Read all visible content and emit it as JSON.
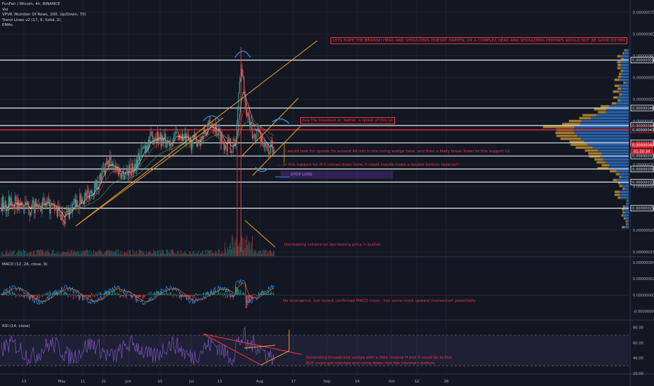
{
  "legend": {
    "symbol": "FunFair / Bitcoin, 4h, BINANCE",
    "vol": "Vol",
    "vpvr": "VPVR (Number Of Rows, 200, Up/Down, 70)",
    "trend": "Trend Lines v2 (17, 9, Solid, 2)",
    "emas": "EMAs"
  },
  "panels": {
    "macd_label": "MACD (12, 26, close, 9)",
    "rsi_label": "RSI (14, close)"
  },
  "annotations": {
    "head_shoulders": "LETS HOPE THE BEARISH HEAD AND SHOULDERS DOESNT HAPPEN, OR A COMPLEX HEAD AND SHOULDERS PERHAPS WOULD NOT BE GOOD EITHER",
    "buy_breakout": "buy the breakout or, better, a retest of this lvl",
    "upside": "I would look for upside (to around 44 ish) in the rising wedge here, and then a likely break lower to this support lvl",
    "support": "... or this support lvl.  If it comes down here, it could maybe make a double bottom reversal?",
    "stop_loss": "STOP LOSS",
    "volume": "Decreasing volume on decreasing price = bullish",
    "macd": "No divergence, but recent confirmed MACD cross - has some more upward momentum potentially",
    "rsi_1": "Decending broadening wedge with a little inverse H and S could be bullish",
    "rsi_2": "BUT could get rejected and come down into the channel's bottom"
  },
  "colors": {
    "background": "#131722",
    "candle_up": "#26a69a",
    "candle_down": "#ef5350",
    "trend_line": "#f0a12b",
    "annotation_red": "#f23645",
    "level_white": "#ffffff",
    "resistance_red": "#e0252f",
    "vpvr_blue": "#2f6fbf",
    "vpvr_gold": "#c89430",
    "rsi_line": "#7e57c2",
    "macd_line": "#2196f3",
    "signal_line": "#ff6d00",
    "arc_blue": "#2196f3"
  },
  "chart_data": [
    {
      "type": "candlestick",
      "title": "FunFair / Bitcoin, 4h, BINANCE",
      "x_ticks": [
        "13",
        "May",
        "11",
        "21",
        "Jun",
        "15",
        "Jul",
        "13",
        "Aug",
        "17",
        "Sep",
        "14",
        "Oct",
        "12",
        "26"
      ],
      "y_ticks": [
        "0.00000070",
        "0.00000065",
        "0.00000060",
        "0.00000055",
        "0.00000050",
        "0.00000045",
        "0.00000040",
        "0.00000035",
        "0.00000030",
        "0.00000025",
        "0.00000020",
        "0.00000015"
      ],
      "price_tags": [
        "0.00000059",
        "0.00000048",
        "0.00000044",
        "0.00000043",
        "0.00000040",
        "0.00000037",
        "0.00000034",
        "0.00000031",
        "0.00000025"
      ],
      "current_price": "0.00000040",
      "countdown": "01:30:34",
      "levels": [
        {
          "value": 5.9e-07,
          "color": "white"
        },
        {
          "value": 4.8e-07,
          "color": "white"
        },
        {
          "value": 4.4e-07,
          "color": "white"
        },
        {
          "value": 4.3e-07,
          "color": "red"
        },
        {
          "value": 4e-07,
          "color": "white"
        },
        {
          "value": 3.7e-07,
          "color": "white"
        },
        {
          "value": 3.4e-07,
          "color": "white"
        },
        {
          "value": 3.1e-07,
          "color": "white"
        },
        {
          "value": 2.5e-07,
          "color": "white"
        }
      ],
      "ylim": [
        1.4e-07,
        7.2e-07
      ],
      "close_path": [
        {
          "t": 0,
          "v": 2.6e-07
        },
        {
          "t": 5,
          "v": 2.6e-07
        },
        {
          "t": 10,
          "v": 2.5e-07
        },
        {
          "t": 14,
          "v": 2.6e-07
        },
        {
          "t": 18,
          "v": 2.5e-07
        },
        {
          "t": 22,
          "v": 2.3e-07
        },
        {
          "t": 26,
          "v": 2.6e-07
        },
        {
          "t": 30,
          "v": 2.8e-07
        },
        {
          "t": 34,
          "v": 3.1e-07
        },
        {
          "t": 38,
          "v": 3.6e-07
        },
        {
          "t": 42,
          "v": 3.3e-07
        },
        {
          "t": 46,
          "v": 3.4e-07
        },
        {
          "t": 50,
          "v": 3.9e-07
        },
        {
          "t": 54,
          "v": 4.2e-07
        },
        {
          "t": 58,
          "v": 4e-07
        },
        {
          "t": 62,
          "v": 4.2e-07
        },
        {
          "t": 66,
          "v": 4e-07
        },
        {
          "t": 70,
          "v": 4.1e-07
        },
        {
          "t": 74,
          "v": 4.5e-07
        },
        {
          "t": 78,
          "v": 4e-07
        },
        {
          "t": 82,
          "v": 3.9e-07
        },
        {
          "t": 84,
          "v": 5.8e-07
        },
        {
          "t": 86,
          "v": 4.8e-07
        },
        {
          "t": 88,
          "v": 4.1e-07
        },
        {
          "t": 90,
          "v": 4.3e-07
        },
        {
          "t": 93,
          "v": 3.8e-07
        },
        {
          "t": 96,
          "v": 4e-07
        }
      ]
    },
    {
      "type": "line",
      "title": "MACD (12, 26, close, 9)",
      "y_ticks": [
        "0.00000004",
        "0.00000002",
        "0.00000000",
        "-0.00000002"
      ],
      "ylim": [
        -3e-08,
        4e-08
      ]
    },
    {
      "type": "line",
      "title": "RSI (14, close)",
      "y_ticks": [
        "80.00",
        "60.00",
        "40.00",
        "20.00"
      ],
      "ylim": [
        20,
        85
      ]
    }
  ]
}
